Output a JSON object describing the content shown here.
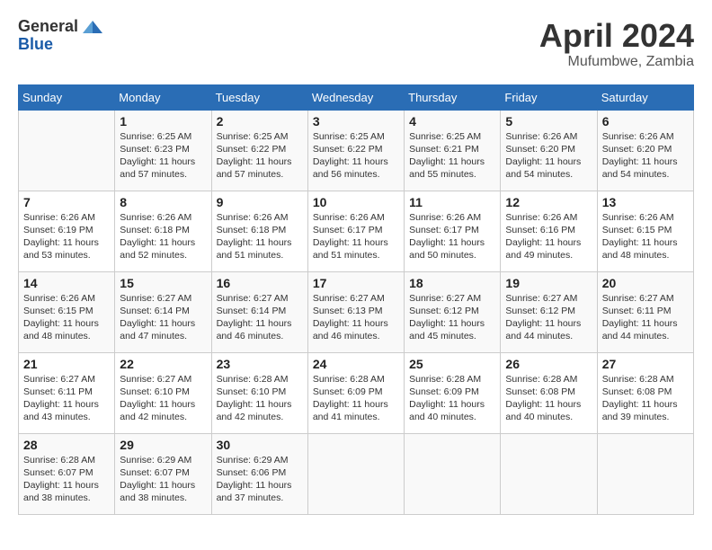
{
  "logo": {
    "line1": "General",
    "line2": "Blue"
  },
  "title": "April 2024",
  "location": "Mufumbwe, Zambia",
  "weekdays": [
    "Sunday",
    "Monday",
    "Tuesday",
    "Wednesday",
    "Thursday",
    "Friday",
    "Saturday"
  ],
  "weeks": [
    [
      {
        "day": "",
        "info": ""
      },
      {
        "day": "1",
        "info": "Sunrise: 6:25 AM\nSunset: 6:23 PM\nDaylight: 11 hours\nand 57 minutes."
      },
      {
        "day": "2",
        "info": "Sunrise: 6:25 AM\nSunset: 6:22 PM\nDaylight: 11 hours\nand 57 minutes."
      },
      {
        "day": "3",
        "info": "Sunrise: 6:25 AM\nSunset: 6:22 PM\nDaylight: 11 hours\nand 56 minutes."
      },
      {
        "day": "4",
        "info": "Sunrise: 6:25 AM\nSunset: 6:21 PM\nDaylight: 11 hours\nand 55 minutes."
      },
      {
        "day": "5",
        "info": "Sunrise: 6:26 AM\nSunset: 6:20 PM\nDaylight: 11 hours\nand 54 minutes."
      },
      {
        "day": "6",
        "info": "Sunrise: 6:26 AM\nSunset: 6:20 PM\nDaylight: 11 hours\nand 54 minutes."
      }
    ],
    [
      {
        "day": "7",
        "info": "Sunrise: 6:26 AM\nSunset: 6:19 PM\nDaylight: 11 hours\nand 53 minutes."
      },
      {
        "day": "8",
        "info": "Sunrise: 6:26 AM\nSunset: 6:18 PM\nDaylight: 11 hours\nand 52 minutes."
      },
      {
        "day": "9",
        "info": "Sunrise: 6:26 AM\nSunset: 6:18 PM\nDaylight: 11 hours\nand 51 minutes."
      },
      {
        "day": "10",
        "info": "Sunrise: 6:26 AM\nSunset: 6:17 PM\nDaylight: 11 hours\nand 51 minutes."
      },
      {
        "day": "11",
        "info": "Sunrise: 6:26 AM\nSunset: 6:17 PM\nDaylight: 11 hours\nand 50 minutes."
      },
      {
        "day": "12",
        "info": "Sunrise: 6:26 AM\nSunset: 6:16 PM\nDaylight: 11 hours\nand 49 minutes."
      },
      {
        "day": "13",
        "info": "Sunrise: 6:26 AM\nSunset: 6:15 PM\nDaylight: 11 hours\nand 48 minutes."
      }
    ],
    [
      {
        "day": "14",
        "info": "Sunrise: 6:26 AM\nSunset: 6:15 PM\nDaylight: 11 hours\nand 48 minutes."
      },
      {
        "day": "15",
        "info": "Sunrise: 6:27 AM\nSunset: 6:14 PM\nDaylight: 11 hours\nand 47 minutes."
      },
      {
        "day": "16",
        "info": "Sunrise: 6:27 AM\nSunset: 6:14 PM\nDaylight: 11 hours\nand 46 minutes."
      },
      {
        "day": "17",
        "info": "Sunrise: 6:27 AM\nSunset: 6:13 PM\nDaylight: 11 hours\nand 46 minutes."
      },
      {
        "day": "18",
        "info": "Sunrise: 6:27 AM\nSunset: 6:12 PM\nDaylight: 11 hours\nand 45 minutes."
      },
      {
        "day": "19",
        "info": "Sunrise: 6:27 AM\nSunset: 6:12 PM\nDaylight: 11 hours\nand 44 minutes."
      },
      {
        "day": "20",
        "info": "Sunrise: 6:27 AM\nSunset: 6:11 PM\nDaylight: 11 hours\nand 44 minutes."
      }
    ],
    [
      {
        "day": "21",
        "info": "Sunrise: 6:27 AM\nSunset: 6:11 PM\nDaylight: 11 hours\nand 43 minutes."
      },
      {
        "day": "22",
        "info": "Sunrise: 6:27 AM\nSunset: 6:10 PM\nDaylight: 11 hours\nand 42 minutes."
      },
      {
        "day": "23",
        "info": "Sunrise: 6:28 AM\nSunset: 6:10 PM\nDaylight: 11 hours\nand 42 minutes."
      },
      {
        "day": "24",
        "info": "Sunrise: 6:28 AM\nSunset: 6:09 PM\nDaylight: 11 hours\nand 41 minutes."
      },
      {
        "day": "25",
        "info": "Sunrise: 6:28 AM\nSunset: 6:09 PM\nDaylight: 11 hours\nand 40 minutes."
      },
      {
        "day": "26",
        "info": "Sunrise: 6:28 AM\nSunset: 6:08 PM\nDaylight: 11 hours\nand 40 minutes."
      },
      {
        "day": "27",
        "info": "Sunrise: 6:28 AM\nSunset: 6:08 PM\nDaylight: 11 hours\nand 39 minutes."
      }
    ],
    [
      {
        "day": "28",
        "info": "Sunrise: 6:28 AM\nSunset: 6:07 PM\nDaylight: 11 hours\nand 38 minutes."
      },
      {
        "day": "29",
        "info": "Sunrise: 6:29 AM\nSunset: 6:07 PM\nDaylight: 11 hours\nand 38 minutes."
      },
      {
        "day": "30",
        "info": "Sunrise: 6:29 AM\nSunset: 6:06 PM\nDaylight: 11 hours\nand 37 minutes."
      },
      {
        "day": "",
        "info": ""
      },
      {
        "day": "",
        "info": ""
      },
      {
        "day": "",
        "info": ""
      },
      {
        "day": "",
        "info": ""
      }
    ]
  ]
}
